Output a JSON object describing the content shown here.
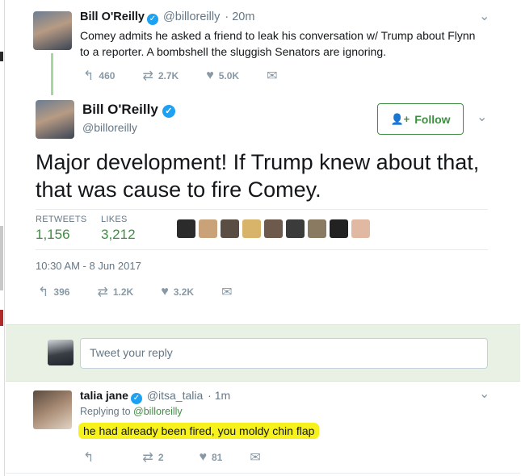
{
  "parent_tweet": {
    "name": "Bill O'Reilly",
    "handle": "@billoreilly",
    "time": "· 20m",
    "text": "Comey admits he asked a friend to leak his conversation w/ Trump about Flynn to a reporter. A bombshell the sluggish Senators are ignoring.",
    "replies": "460",
    "retweets": "2.7K",
    "likes": "5.0K"
  },
  "main_tweet": {
    "name": "Bill O'Reilly",
    "handle": "@billoreilly",
    "follow_label": "Follow",
    "text": "Major development!  If Trump knew about that, that was cause to fire Comey.",
    "retweets_label": "RETWEETS",
    "retweets_value": "1,156",
    "likes_label": "LIKES",
    "likes_value": "3,212",
    "timestamp": "10:30 AM - 8 Jun 2017",
    "replies": "396",
    "retweets": "1.2K",
    "likes": "3.2K",
    "liker_colors": [
      "#2b2b2b",
      "#c9a27a",
      "#5a4d44",
      "#d7b46a",
      "#6e5a4c",
      "#3b3b3b",
      "#8a7a62",
      "#222222",
      "#e1b9a2"
    ]
  },
  "reply_box": {
    "placeholder": "Tweet your reply"
  },
  "reply_tweet": {
    "name": "talia jane",
    "handle": "@itsa_talia",
    "time": "· 1m",
    "replying_prefix": "Replying to",
    "replying_to": "@billoreilly",
    "text": "he had already been fired, you moldy chin flap",
    "retweets": "2",
    "likes": "81"
  },
  "colors": {
    "accent": "#3e8e41",
    "verified": "#1da1f2",
    "highlight": "#f7f21c"
  }
}
